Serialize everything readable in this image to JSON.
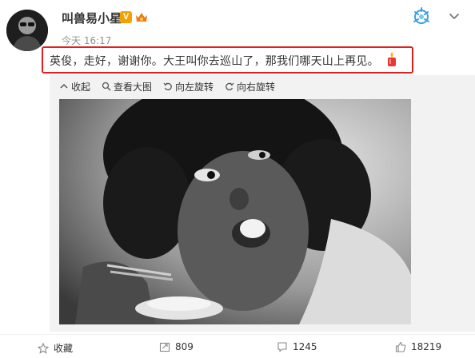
{
  "author": {
    "name": "叫兽易小星",
    "verified_badge": "V",
    "avatar_icon": "avatar-image",
    "vip_badge_icon": "vip-crown-badge"
  },
  "post": {
    "timestamp": "今天 16:17",
    "text": "英俊，走好，谢谢你。大王叫你去巡山了，那我们哪天山上再见。",
    "emoji_icon": "candle-icon",
    "highlight_color": "#e02020"
  },
  "media_toolbar": {
    "collapse": "收起",
    "view_large": "查看大图",
    "rotate_left": "向左旋转",
    "rotate_right": "向右旋转"
  },
  "footer": {
    "collect": "收藏",
    "repost_count": "809",
    "comment_count": "1245",
    "like_count": "18219"
  },
  "colors": {
    "accent_orange": "#f4a100",
    "muted_text": "#939393",
    "media_bg": "#f2f2f2"
  }
}
